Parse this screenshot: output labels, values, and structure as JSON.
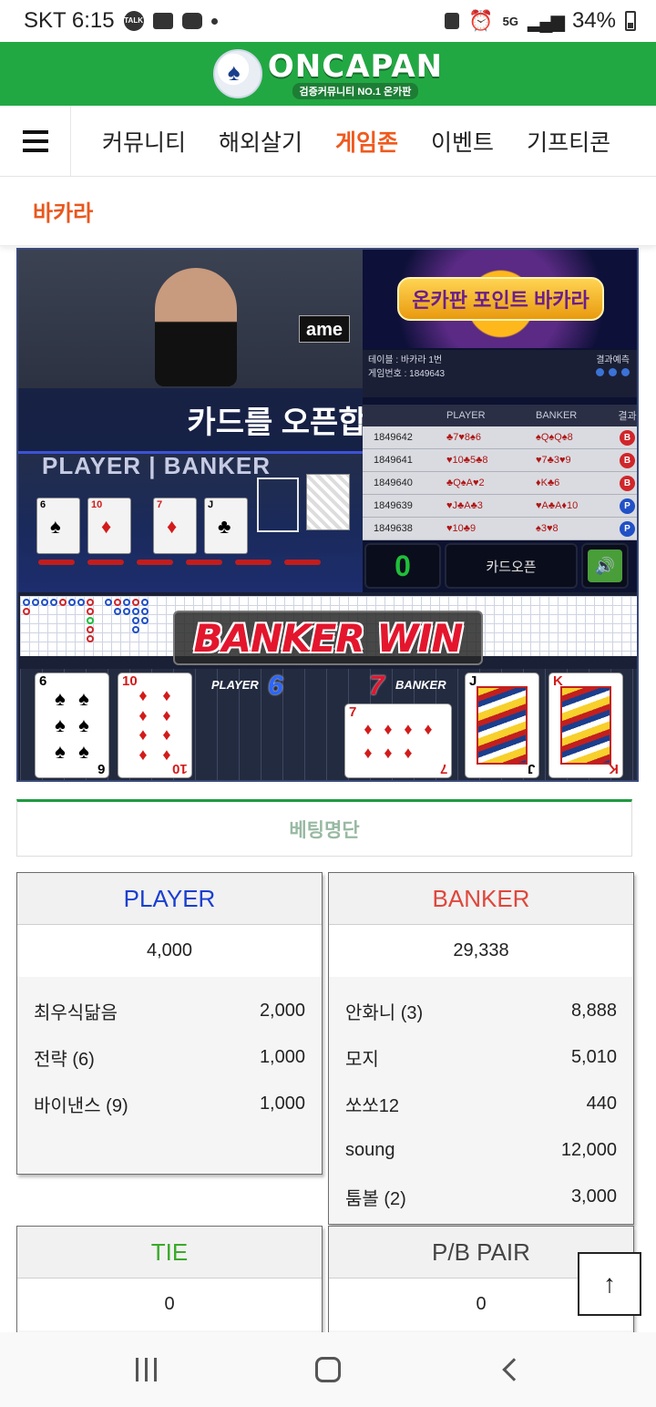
{
  "status_bar": {
    "carrier_time": "SKT 6:15",
    "talk_icon_text": "TALK",
    "network": "5G",
    "battery": "34%"
  },
  "brand": {
    "title": "ONCAPAN",
    "subtitle": "검증커뮤니티 NO.1 온카판",
    "color": "#22a843"
  },
  "nav": {
    "items": [
      {
        "label": "커뮤니티"
      },
      {
        "label": "해외살기"
      },
      {
        "label": "게임존",
        "active": true
      },
      {
        "label": "이벤트"
      },
      {
        "label": "기프티콘"
      }
    ],
    "accent": "#ef5a1e"
  },
  "page": {
    "title": "바카라"
  },
  "game": {
    "video_sign": "ame",
    "player_banker_label": "PLAYER | BANKER",
    "notice": "카드를 오픈합니다.",
    "panel_title": "온카판 포인트 바카라",
    "table_name": "테이블 : 바카라 1번",
    "game_no": "게임번호 : 1849643",
    "prediction_label": "결과예측",
    "prediction_player": "PLAYER",
    "prediction_banker": "BANKER",
    "history_header": [
      "",
      "PLAYER",
      "BANKER",
      "결과"
    ],
    "history": [
      {
        "no": "1849642",
        "player": "♣7♥8♠6",
        "banker": "♠Q♠Q♠8",
        "result": "B"
      },
      {
        "no": "1849641",
        "player": "♥10♣5♣8",
        "banker": "♥7♣3♥9",
        "result": "B"
      },
      {
        "no": "1849640",
        "player": "♣Q♠A♥2",
        "banker": "♦K♣6",
        "result": "B"
      },
      {
        "no": "1849639",
        "player": "♥J♣A♣3",
        "banker": "♥A♣A♦10",
        "result": "P"
      },
      {
        "no": "1849638",
        "player": "♥10♣9",
        "banker": "♠3♥8",
        "result": "P"
      }
    ],
    "countdown": "0",
    "open_button": "카드오픈",
    "win_text": "BANKER WIN",
    "player_label": "PLAYER",
    "player_score": "6",
    "banker_label": "BANKER",
    "banker_score": "7",
    "player_cards": [
      {
        "rank": "6",
        "suit": "♠",
        "color": "black"
      },
      {
        "rank": "10",
        "suit": "♦",
        "color": "red"
      }
    ],
    "banker_cards": [
      {
        "rank": "7",
        "suit": "♦",
        "color": "red"
      },
      {
        "rank": "J",
        "suit": "♣",
        "color": "black"
      },
      {
        "rank": "K",
        "suit": "♦",
        "color": "red"
      }
    ]
  },
  "bets": {
    "section_title": "베팅명단",
    "player": {
      "title": "PLAYER",
      "total": "4,000",
      "entries": [
        {
          "name": "최우식닮음",
          "amount": "2,000"
        },
        {
          "name": "전략 (6)",
          "amount": "1,000"
        },
        {
          "name": "바이낸스 (9)",
          "amount": "1,000"
        }
      ]
    },
    "banker": {
      "title": "BANKER",
      "total": "29,338",
      "entries": [
        {
          "name": "안화니 (3)",
          "amount": "8,888"
        },
        {
          "name": "모지",
          "amount": "5,010"
        },
        {
          "name": "쏘쏘12",
          "amount": "440"
        },
        {
          "name": "soung",
          "amount": "12,000"
        },
        {
          "name": "툼볼 (2)",
          "amount": "3,000"
        }
      ]
    },
    "tie": {
      "title": "TIE",
      "total": "0"
    },
    "pair": {
      "title": "P/B PAIR",
      "total": "0"
    }
  }
}
